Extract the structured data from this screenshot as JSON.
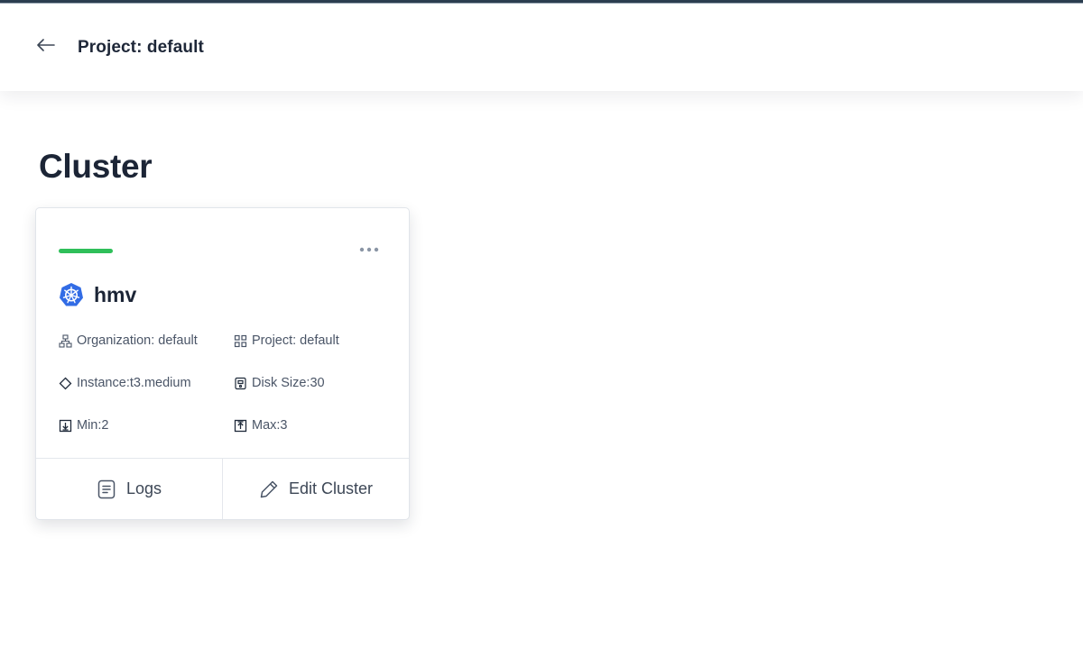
{
  "header": {
    "title": "Project: default"
  },
  "page": {
    "title": "Cluster"
  },
  "cluster_card": {
    "status_color": "#2fbf5a",
    "name": "hmv",
    "organization": "Organization: default",
    "project": "Project: default",
    "instance": "Instance:t3.medium",
    "disk_size": "Disk Size:30",
    "min": "Min:2",
    "max": "Max:3",
    "logs_label": "Logs",
    "edit_label": "Edit Cluster"
  },
  "icons": {
    "back": "arrow-left-icon",
    "more": "more-horizontal-icon",
    "cluster": "kubernetes-icon",
    "organization": "org-chart-icon",
    "project": "grid-icon",
    "instance": "diamond-icon",
    "disk": "disk-icon",
    "min": "arrow-down-box-icon",
    "max": "arrow-up-box-icon",
    "logs": "document-icon",
    "edit": "pencil-icon"
  }
}
